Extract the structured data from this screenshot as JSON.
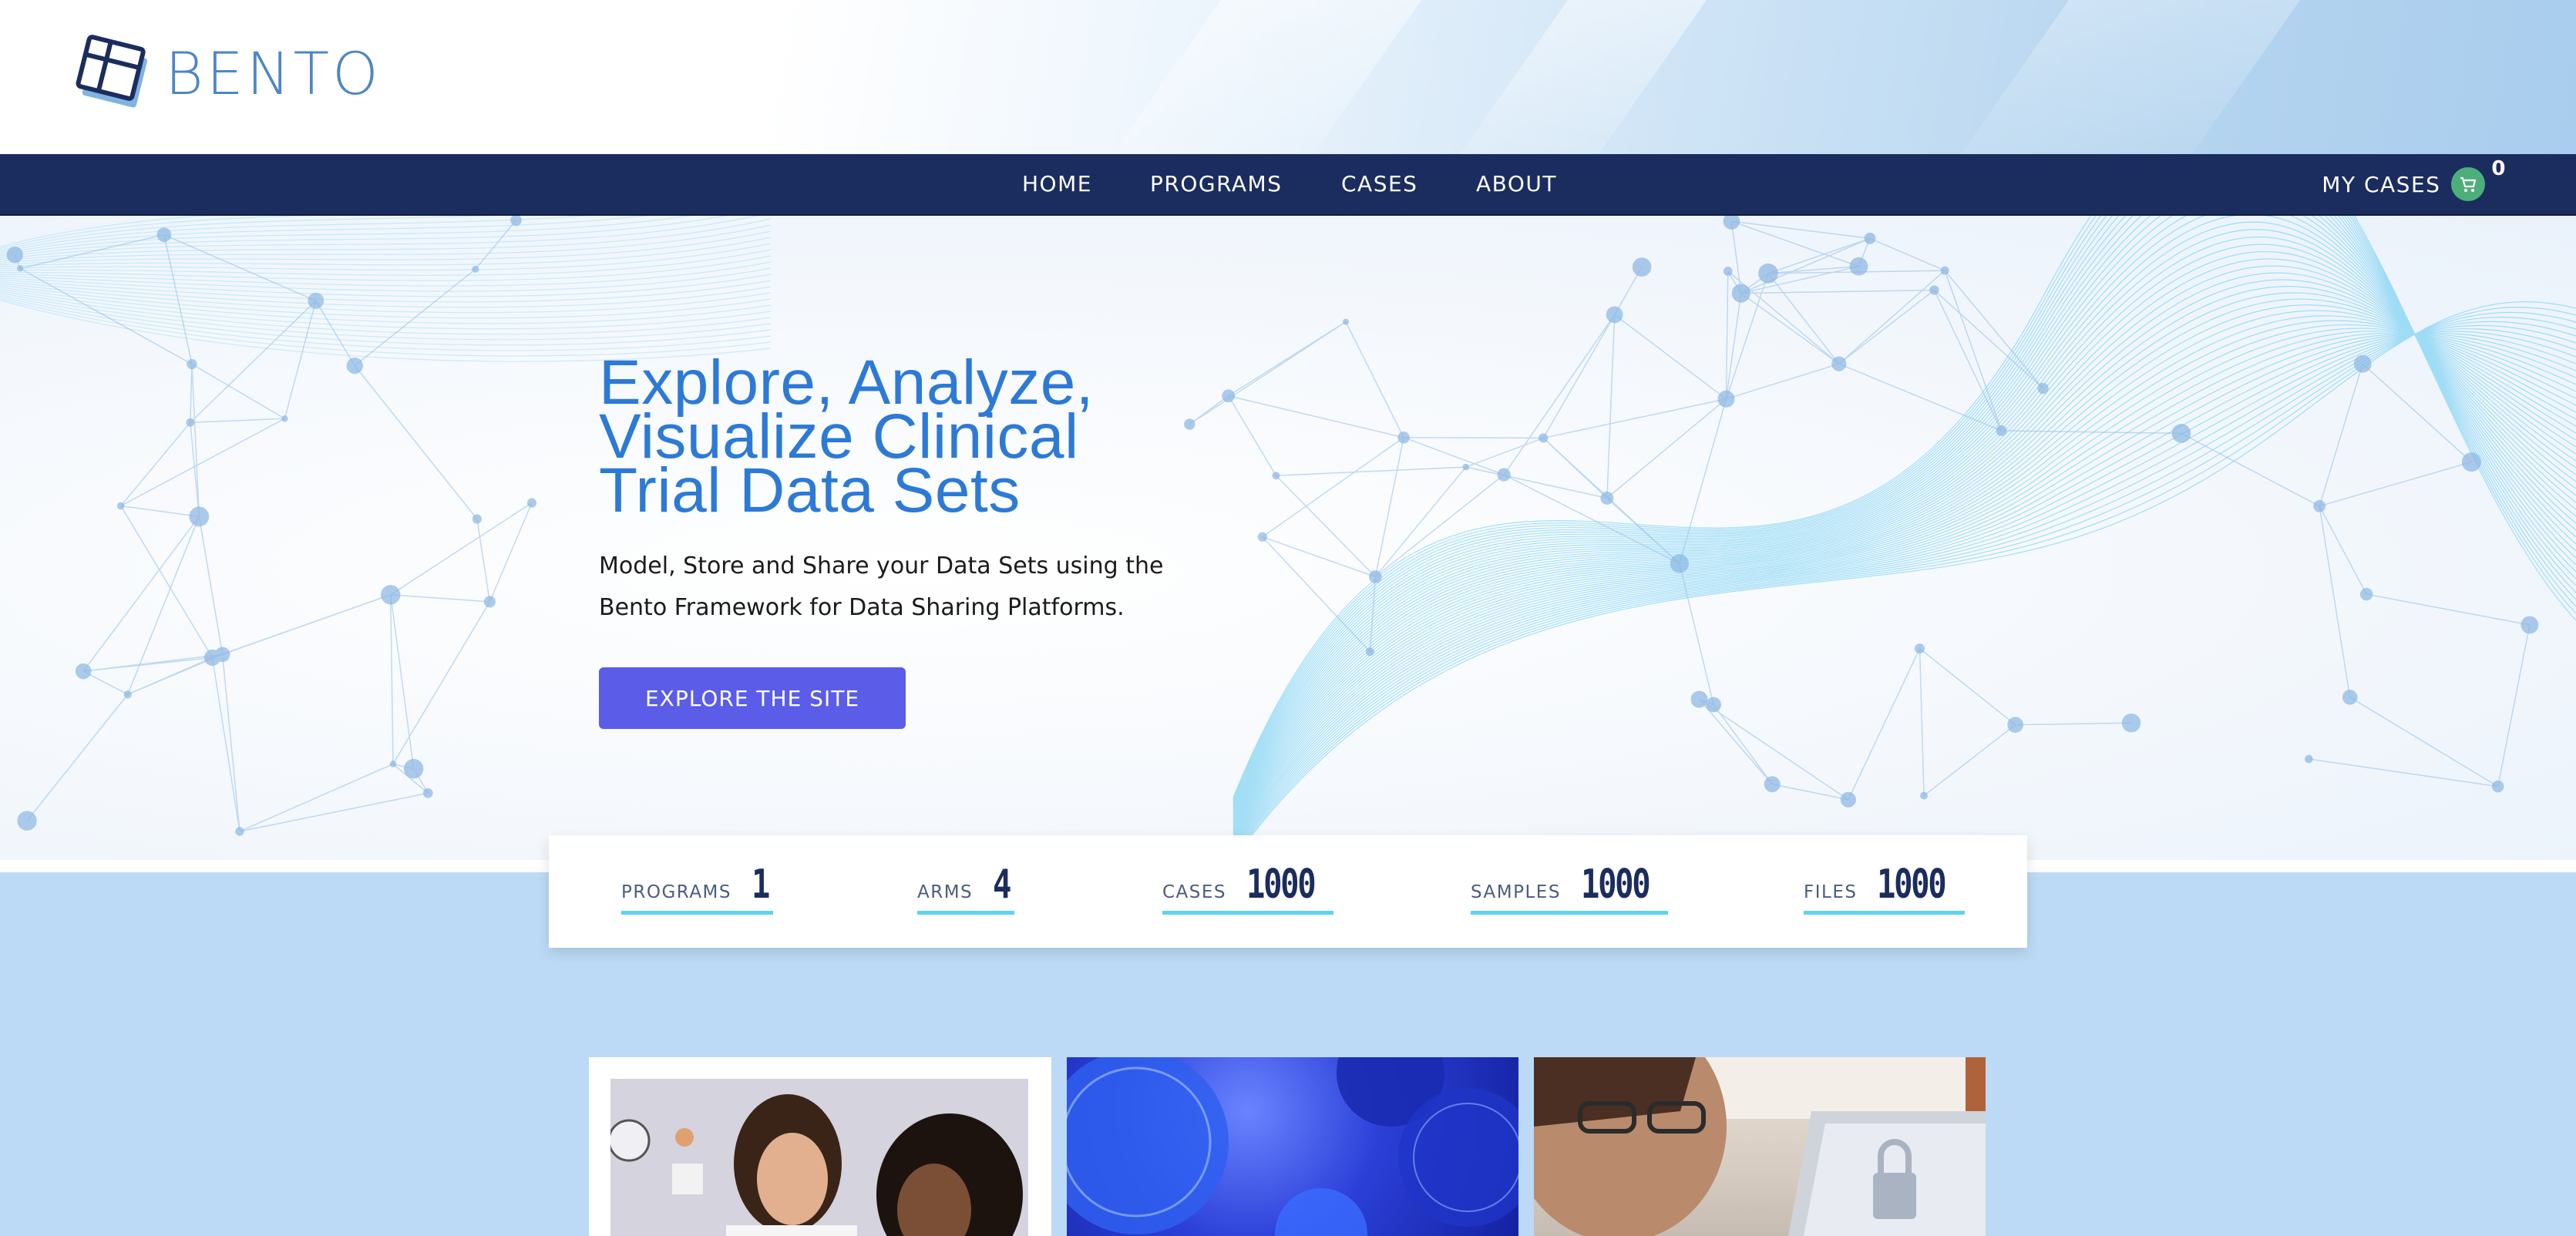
{
  "header": {
    "logo_text": "BENTO"
  },
  "nav": {
    "items": [
      {
        "label": "HOME"
      },
      {
        "label": "PROGRAMS"
      },
      {
        "label": "CASES"
      },
      {
        "label": "ABOUT"
      }
    ],
    "my_cases": {
      "label": "MY CASES",
      "count": "0"
    }
  },
  "hero": {
    "title_lines": [
      "Explore, Analyze,",
      "Visualize Clinical",
      "Trial Data Sets"
    ],
    "subtitle": "Model, Store and Share your Data Sets using the Bento Framework for Data Sharing Platforms.",
    "button_label": "EXPLORE THE SITE"
  },
  "stats": [
    {
      "label": "PROGRAMS",
      "value": "1"
    },
    {
      "label": "ARMS",
      "value": "4"
    },
    {
      "label": "CASES",
      "value": "1000"
    },
    {
      "label": "SAMPLES",
      "value": "1000"
    },
    {
      "label": "FILES",
      "value": "1000"
    }
  ],
  "colors": {
    "nav_bg": "#1b2d5e",
    "hero_title": "#2d7ad6",
    "button_bg": "#5b5ce8",
    "stat_underline": "#5fd3ee",
    "lower_bg": "#bcdaf5",
    "cart_badge": "#4caf7a"
  },
  "icons": {
    "logo": "bento-box-logo-icon",
    "cart": "shopping-cart-icon"
  }
}
